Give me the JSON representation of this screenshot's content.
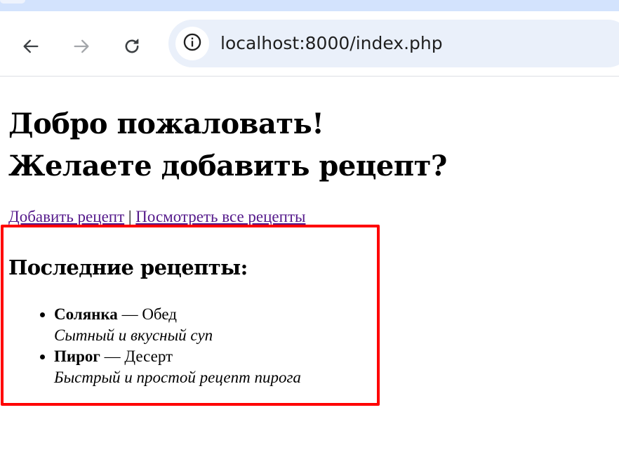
{
  "browser": {
    "url": "localhost:8000/index.php",
    "icons": {
      "back": "arrow-left-icon",
      "forward": "arrow-right-icon",
      "reload": "reload-icon",
      "site_info": "info-circle-icon"
    }
  },
  "page": {
    "heading_line1": "Добро пожаловать!",
    "heading_line2": "Желаете добавить рецепт?",
    "nav": {
      "add_recipe": "Добавить рецепт",
      "separator": "|",
      "view_all": "Посмотреть все рецепты"
    },
    "latest_title": "Последние рецепты:",
    "recipes": [
      {
        "name": "Солянка",
        "dash": "—",
        "category": "Обед",
        "description": "Сытный и вкусный суп"
      },
      {
        "name": "Пирог",
        "dash": "—",
        "category": "Десерт",
        "description": "Быстрый и простой рецепт пирога"
      }
    ]
  },
  "colors": {
    "link": "#551a8b",
    "highlight": "#ff0000",
    "omnibox": "#eaf0fa",
    "tabstrip": "#d3e3fd"
  }
}
